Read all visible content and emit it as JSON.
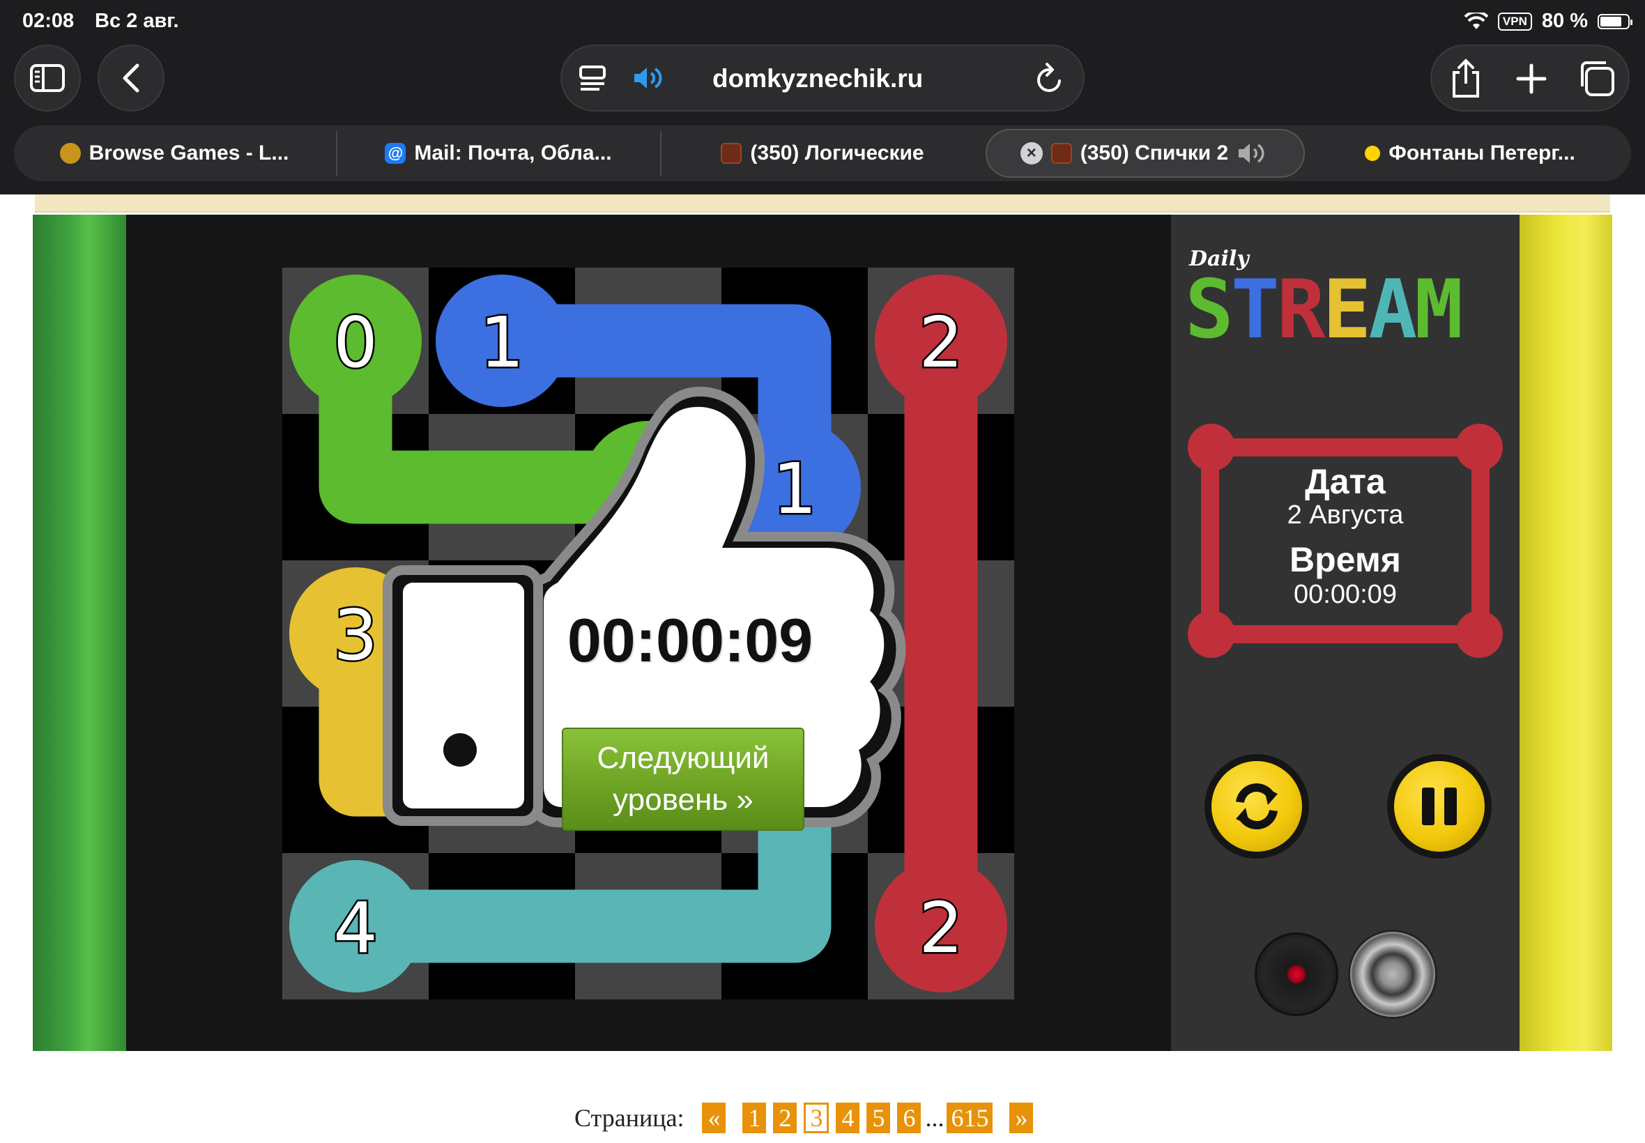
{
  "status_bar": {
    "time": "02:08",
    "date": "Вс 2 авг.",
    "vpn": "VPN",
    "battery": "80 %",
    "battery_level": 0.8
  },
  "browser": {
    "url": "domkyznechik.ru",
    "tabs": [
      {
        "label": "Browse Games - L...",
        "icon": "game-site-icon"
      },
      {
        "label": "Mail: Почта, Обла...",
        "icon": "mail-icon"
      },
      {
        "label": "(350) Логические",
        "icon": "game-thumbnail-icon"
      },
      {
        "label": "(350) Спички 2",
        "icon": "game-thumbnail-icon",
        "active": true,
        "audio": true
      },
      {
        "label": "Фонтаны Петерг...",
        "icon": "location-icon"
      }
    ]
  },
  "game": {
    "logo_small": "Daily",
    "logo_big": "STREAM",
    "logo_colors": [
      "#5dbb2f",
      "#3c6fe0",
      "#c0303a",
      "#e6c131",
      "#4fb6b6"
    ],
    "info": {
      "date_label": "Дата",
      "date_value": "2 Августа",
      "time_label": "Время",
      "time_value": "00:00:09"
    },
    "board_numbers": [
      {
        "label": "0",
        "color": "#5dbb2f"
      },
      {
        "label": "1",
        "color": "#3c6fe0"
      },
      {
        "label": "2",
        "color": "#c0303a"
      },
      {
        "label": "1",
        "color": "#3c6fe0"
      },
      {
        "label": "3",
        "color": "#e6c131"
      },
      {
        "label": "4",
        "color": "#5ab5b5"
      },
      {
        "label": "2",
        "color": "#c0303a"
      }
    ],
    "win_overlay": {
      "timer": "00:00:09",
      "next_line1": "Следующий",
      "next_line2": "уровень »"
    }
  },
  "pagination": {
    "label": "Страница:",
    "prev": "«",
    "pages": [
      "1",
      "2",
      "3",
      "4",
      "5",
      "6"
    ],
    "current": "3",
    "ellipsis": "...",
    "last": "615",
    "next": "»"
  }
}
